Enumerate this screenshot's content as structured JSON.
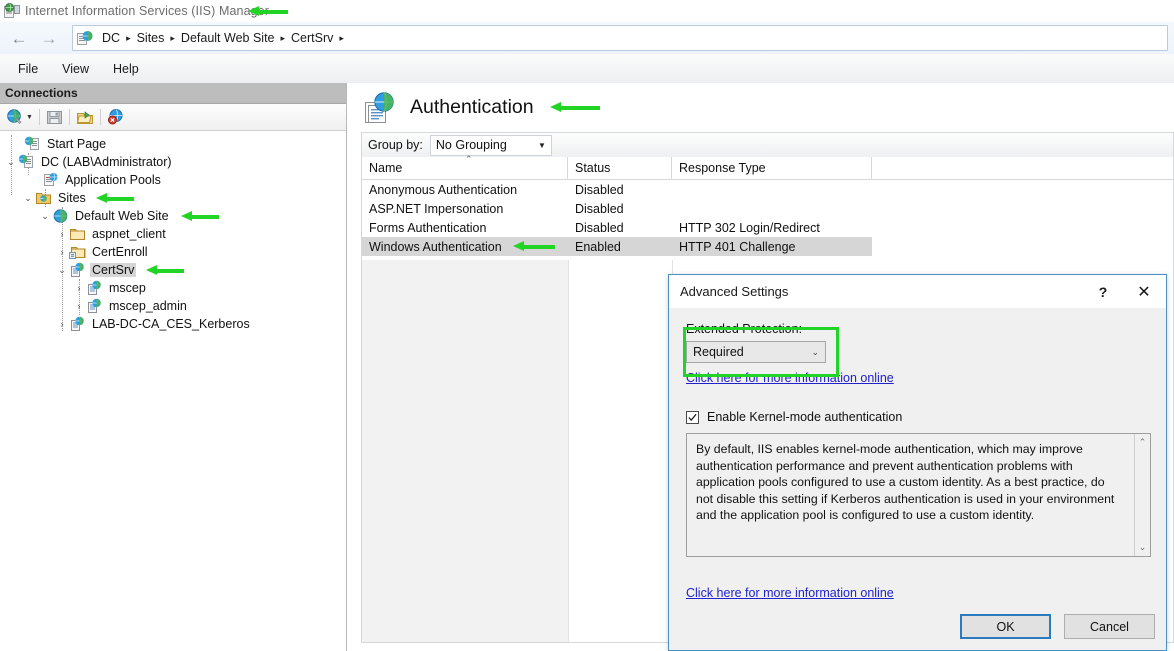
{
  "window": {
    "title": "Internet Information Services (IIS) Manager",
    "icon": "iis-manager-icon"
  },
  "addressbar": {
    "back_icon": "back-arrow-icon",
    "forward_icon": "forward-arrow-icon",
    "site_icon": "server-page-icon",
    "separator": "▸",
    "crumbs": [
      "DC",
      "Sites",
      "Default Web Site",
      "CertSrv"
    ]
  },
  "menubar": {
    "items": [
      "File",
      "View",
      "Help"
    ]
  },
  "connections": {
    "header": "Connections",
    "toolbar": [
      {
        "name": "connect-to-icon",
        "label": ""
      },
      {
        "name": "save-connections-icon",
        "label": ""
      },
      {
        "name": "open-connection-icon",
        "label": ""
      },
      {
        "name": "delete-connection-icon",
        "label": ""
      }
    ],
    "tree": [
      {
        "label": "Start Page",
        "icon": "start-page-icon",
        "depth": 0,
        "expander": "",
        "selected": false
      },
      {
        "label": "DC (LAB\\Administrator)",
        "icon": "server-icon",
        "depth": 0,
        "expander": "⌄",
        "selected": false
      },
      {
        "label": "Application Pools",
        "icon": "app-pools-icon",
        "depth": 1,
        "expander": "",
        "selected": false
      },
      {
        "label": "Sites",
        "icon": "sites-folder-icon",
        "depth": 1,
        "expander": "⌄",
        "selected": false
      },
      {
        "label": "Default Web Site",
        "icon": "website-icon",
        "depth": 2,
        "expander": "⌄",
        "selected": false
      },
      {
        "label": "aspnet_client",
        "icon": "folder-icon",
        "depth": 3,
        "expander": "›",
        "selected": false
      },
      {
        "label": "CertEnroll",
        "icon": "virtual-directory-icon",
        "depth": 3,
        "expander": "›",
        "selected": false
      },
      {
        "label": "CertSrv",
        "icon": "application-icon",
        "depth": 3,
        "expander": "⌄",
        "selected": true
      },
      {
        "label": "mscep",
        "icon": "application-icon",
        "depth": 4,
        "expander": "›",
        "selected": false
      },
      {
        "label": "mscep_admin",
        "icon": "application-icon",
        "depth": 4,
        "expander": "›",
        "selected": false
      },
      {
        "label": "LAB-DC-CA_CES_Kerberos",
        "icon": "application-icon",
        "depth": 3,
        "expander": "›",
        "selected": false
      }
    ]
  },
  "feature_page": {
    "icon": "authentication-icon",
    "title": "Authentication",
    "groupby_label": "Group by:",
    "groupby_value": "No Grouping",
    "columns": [
      "Name",
      "Status",
      "Response Type"
    ],
    "sort_indicator": "⌃",
    "rows": [
      {
        "name": "Anonymous Authentication",
        "status": "Disabled",
        "response": "",
        "selected": false
      },
      {
        "name": "ASP.NET Impersonation",
        "status": "Disabled",
        "response": "",
        "selected": false
      },
      {
        "name": "Forms Authentication",
        "status": "Disabled",
        "response": "HTTP 302 Login/Redirect",
        "selected": false
      },
      {
        "name": "Windows Authentication",
        "status": "Enabled",
        "response": "HTTP 401 Challenge",
        "selected": true
      }
    ]
  },
  "dialog": {
    "title": "Advanced Settings",
    "help_glyph": "?",
    "close_glyph": "✕",
    "extended_protection_label": "Extended Protection:",
    "extended_protection_value": "Required",
    "combo_caret": "⌄",
    "link_top": "Click here for more information online",
    "kernel_mode_label": "Enable Kernel-mode authentication",
    "kernel_mode_checked": true,
    "description": "By default, IIS enables kernel-mode authentication, which may improve authentication performance and prevent authentication problems with application pools configured to use a custom identity. As a best practice, do not disable this setting if Kerberos authentication is used in your environment and the application pool is configured to use a custom identity.",
    "scroll_up": "⌃",
    "scroll_down": "⌄",
    "link_bottom": "Click here for more information online",
    "ok_label": "OK",
    "cancel_label": "Cancel"
  },
  "annotations": {
    "color": "#22d426",
    "arrows": [
      {
        "name": "arrow-to-window-title",
        "target": "window-title"
      },
      {
        "name": "arrow-to-sites-node",
        "target": "sidebar-item-sites"
      },
      {
        "name": "arrow-to-default-web-site-node",
        "target": "sidebar-item-default-web-site"
      },
      {
        "name": "arrow-to-certsrv-node",
        "target": "sidebar-item-certsrv"
      },
      {
        "name": "arrow-to-authentication-title",
        "target": "page-title"
      },
      {
        "name": "arrow-to-windows-authentication-row",
        "target": "row-windows-authentication"
      }
    ],
    "highlight_boxes": [
      {
        "name": "highlight-extended-protection",
        "target": "extended-protection-field"
      }
    ]
  },
  "colors": {
    "accent_blue": "#2a7bbd",
    "annotation_green": "#22d426",
    "selection_gray": "#d6d6d6",
    "link_blue": "#2222cc"
  }
}
